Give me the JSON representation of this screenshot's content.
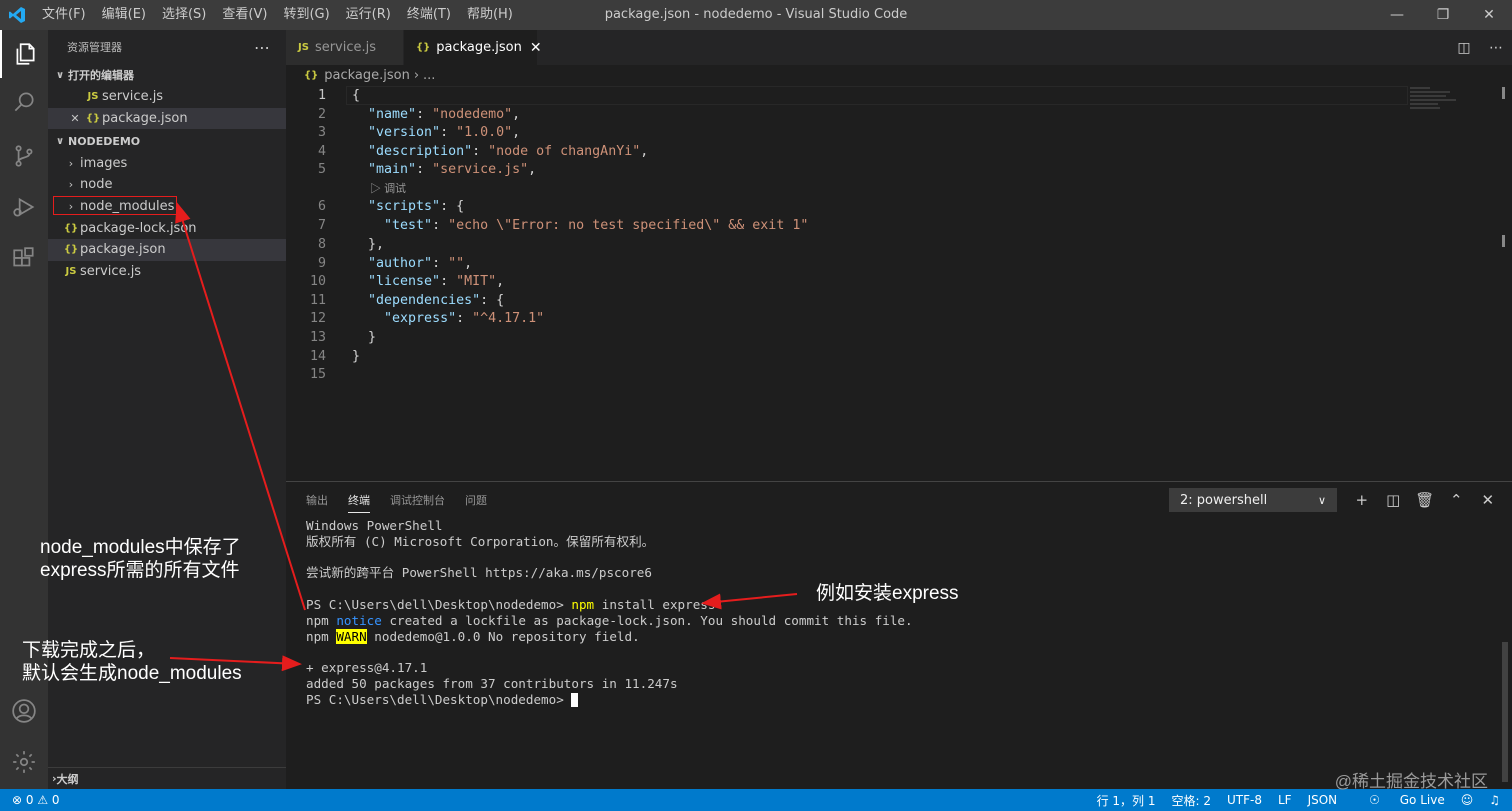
{
  "titlebar": {
    "title": "package.json - nodedemo - Visual Studio Code",
    "menu": [
      "文件(F)",
      "编辑(E)",
      "选择(S)",
      "查看(V)",
      "转到(G)",
      "运行(R)",
      "终端(T)",
      "帮助(H)"
    ]
  },
  "sidebar": {
    "header": "资源管理器",
    "open_editors_title": "打开的编辑器",
    "open_editors": [
      {
        "icon": "JS",
        "name": "service.js"
      },
      {
        "icon": "{}",
        "name": "package.json"
      }
    ],
    "project_title": "NODEDEMO",
    "tree": [
      {
        "name": "images",
        "type": "folder"
      },
      {
        "name": "node",
        "type": "folder"
      },
      {
        "name": "node_modules",
        "type": "folder"
      },
      {
        "name": "package-lock.json",
        "type": "json"
      },
      {
        "name": "package.json",
        "type": "json"
      },
      {
        "name": "service.js",
        "type": "js"
      }
    ],
    "outline_title": "大纲"
  },
  "tabs": [
    {
      "icon": "JS",
      "label": "service.js"
    },
    {
      "icon": "{}",
      "label": "package.json"
    }
  ],
  "breadcrumb": {
    "file": "package.json",
    "rest": "..."
  },
  "editor": {
    "codelens": "调试",
    "lines": [
      "1",
      "2",
      "3",
      "4",
      "5",
      "6",
      "7",
      "8",
      "9",
      "10",
      "11",
      "12",
      "13",
      "14",
      "15"
    ],
    "package": {
      "name": "\"nodedemo\"",
      "version": "\"1.0.0\"",
      "description": "\"node of changAnYi\"",
      "main": "\"service.js\"",
      "test": "\"echo \\\"Error: no test specified\\\" && exit 1\"",
      "author": "\"\"",
      "license": "\"MIT\"",
      "express": "\"^4.17.1\""
    }
  },
  "panel": {
    "tabs": [
      "输出",
      "终端",
      "调试控制台",
      "问题"
    ],
    "terminal_select": "2: powershell",
    "terminal": {
      "l1": "Windows PowerShell",
      "l2": "版权所有 (C) Microsoft Corporation。保留所有权利。",
      "l3": "尝试新的跨平台 PowerShell https://aka.ms/pscore6",
      "prompt": "PS C:\\Users\\dell\\Desktop\\nodedemo>",
      "cmd_npm": "npm",
      "cmd_rest": "install express",
      "notice_word": "notice",
      "notice_rest": "created a lockfile as package-lock.json. You should commit this file.",
      "warn_word": "WARN",
      "warn_rest": "nodedemo@1.0.0 No repository field.",
      "added_pkg": "+ express@4.17.1",
      "added_summary": "added 50 packages from 37 contributors in 11.247s"
    }
  },
  "statusbar": {
    "problems": "⊗ 0 ⚠ 0",
    "position": "行 1，列 1",
    "spaces": "空格: 2",
    "encoding": "UTF-8",
    "eol": "LF",
    "language": "JSON",
    "golive": "Go Live"
  },
  "annotations": {
    "a1_l1": "node_modules中保存了",
    "a1_l2": "express所需的所有文件",
    "a2_l1": "下载完成之后，",
    "a2_l2": "默认会生成node_modules",
    "a3": "例如安装express",
    "color": "#e51d1d"
  },
  "watermark": "@稀土掘金技术社区"
}
